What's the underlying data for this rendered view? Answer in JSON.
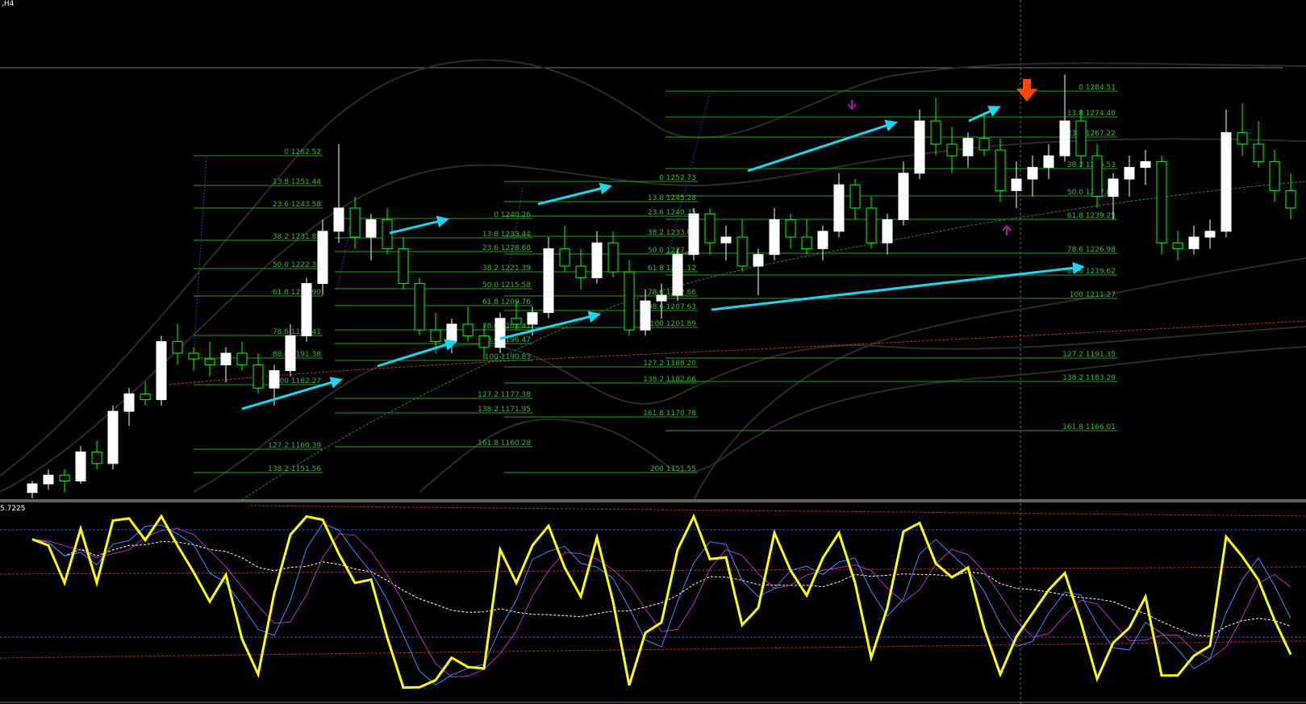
{
  "window_title": ",H4",
  "oscillator": {
    "value_label": "5.7225"
  },
  "colors": {
    "background": "#000000",
    "fib": "#1f9e1f",
    "fib_text": "#2fb82f",
    "bull_candle": "#ffffff",
    "bear_candle": "#00ff00",
    "arrow": "#1ad6f0",
    "sell_arrow": "#ff4500",
    "fractal": "#a020a0",
    "stoch_main": "#ffff00",
    "stoch_blue": "#3a8cff",
    "stoch_magenta": "#b030c0",
    "levels": "#c02020",
    "envelope": "#2a2a2a"
  },
  "fib_sets": [
    {
      "id": "fib-set-1",
      "levels": [
        "0 1262.52",
        "13.8 1251.44",
        "23.6 1243.58",
        "38.2 1231.85",
        "50.0 1222.38",
        "61.8 1212.90",
        "78.6 1199.41",
        "88.6 1191.38",
        "100 1182.27",
        "127.2 1160.39",
        "138.2 1151.56"
      ]
    },
    {
      "id": "fib-set-2",
      "levels": [
        "0 1240.26",
        "13.8 1233.44",
        "23.6 1228.60",
        "38.2 1221.39",
        "50.0 1215.58",
        "61.8 1209.76",
        "78.6 1201.41",
        "88.6 1196.47",
        "100 1190.83",
        "127.2 1177.38",
        "138.2 1171.95",
        "161.8 1160.28"
      ]
    },
    {
      "id": "fib-set-3",
      "levels": [
        "0 1252.73",
        "13.8 1245.28",
        "23.6 1240.35",
        "38.2 1233.08",
        "50.0 1227.23",
        "61.8 1221.12",
        "78.6 1212.66",
        "88.6 1207.63",
        "100 1201.89",
        "127.2 1188.20",
        "138.2 1182.66",
        "161.8 1170.78",
        "200 1151.55"
      ]
    },
    {
      "id": "fib-set-4",
      "levels": [
        "0 1284.51",
        "13.8 1274.40",
        "23.6 1267.22",
        "38.2 1256.53",
        "50.0 1247.89",
        "61.8 1239.25",
        "78.6 1226.98",
        "88.6 1219.62",
        "100 1211.27",
        "127.2 1191.35",
        "138.2 1183.29",
        "161.8 1166.01"
      ]
    }
  ],
  "chart_data": {
    "type": "candlestick",
    "timeframe": "H4",
    "series": [
      {
        "name": "price",
        "ohlc_approx": [
          [
            1142,
            1146,
            1140,
            1145
          ],
          [
            1145,
            1150,
            1143,
            1148
          ],
          [
            1148,
            1150,
            1142,
            1146
          ],
          [
            1146,
            1158,
            1145,
            1156
          ],
          [
            1156,
            1160,
            1150,
            1152
          ],
          [
            1152,
            1172,
            1150,
            1170
          ],
          [
            1170,
            1178,
            1165,
            1176
          ],
          [
            1176,
            1180,
            1172,
            1174
          ],
          [
            1174,
            1196,
            1172,
            1194
          ],
          [
            1194,
            1200,
            1186,
            1190
          ],
          [
            1190,
            1192,
            1184,
            1188
          ],
          [
            1188,
            1194,
            1182,
            1186
          ],
          [
            1186,
            1192,
            1180,
            1190
          ],
          [
            1190,
            1194,
            1184,
            1186
          ],
          [
            1186,
            1190,
            1176,
            1178
          ],
          [
            1178,
            1186,
            1172,
            1184
          ],
          [
            1184,
            1200,
            1182,
            1196
          ],
          [
            1196,
            1216,
            1194,
            1214
          ],
          [
            1214,
            1236,
            1210,
            1232
          ],
          [
            1232,
            1262,
            1228,
            1240
          ],
          [
            1240,
            1244,
            1226,
            1230
          ],
          [
            1230,
            1238,
            1222,
            1236
          ],
          [
            1236,
            1240,
            1224,
            1226
          ],
          [
            1226,
            1230,
            1212,
            1214
          ],
          [
            1214,
            1216,
            1196,
            1198
          ],
          [
            1198,
            1204,
            1190,
            1194
          ],
          [
            1194,
            1202,
            1190,
            1200
          ],
          [
            1200,
            1206,
            1194,
            1196
          ],
          [
            1196,
            1200,
            1188,
            1192
          ],
          [
            1192,
            1204,
            1190,
            1202
          ],
          [
            1202,
            1208,
            1198,
            1200
          ],
          [
            1200,
            1206,
            1196,
            1204
          ],
          [
            1204,
            1230,
            1202,
            1226
          ],
          [
            1226,
            1234,
            1218,
            1220
          ],
          [
            1220,
            1226,
            1212,
            1216
          ],
          [
            1216,
            1232,
            1214,
            1228
          ],
          [
            1228,
            1232,
            1216,
            1218
          ],
          [
            1218,
            1222,
            1196,
            1198
          ],
          [
            1198,
            1212,
            1196,
            1208
          ],
          [
            1208,
            1214,
            1202,
            1210
          ],
          [
            1210,
            1226,
            1208,
            1224
          ],
          [
            1224,
            1240,
            1222,
            1238
          ],
          [
            1238,
            1240,
            1224,
            1228
          ],
          [
            1228,
            1234,
            1222,
            1230
          ],
          [
            1230,
            1236,
            1218,
            1220
          ],
          [
            1220,
            1226,
            1210,
            1224
          ],
          [
            1224,
            1240,
            1222,
            1236
          ],
          [
            1236,
            1238,
            1226,
            1230
          ],
          [
            1230,
            1236,
            1224,
            1226
          ],
          [
            1226,
            1234,
            1222,
            1232
          ],
          [
            1232,
            1252,
            1230,
            1248
          ],
          [
            1248,
            1250,
            1236,
            1240
          ],
          [
            1240,
            1244,
            1226,
            1228
          ],
          [
            1228,
            1238,
            1224,
            1236
          ],
          [
            1236,
            1256,
            1234,
            1252
          ],
          [
            1252,
            1274,
            1250,
            1270
          ],
          [
            1270,
            1278,
            1258,
            1262
          ],
          [
            1262,
            1268,
            1252,
            1258
          ],
          [
            1258,
            1266,
            1254,
            1264
          ],
          [
            1264,
            1272,
            1258,
            1260
          ],
          [
            1260,
            1264,
            1242,
            1246
          ],
          [
            1246,
            1256,
            1240,
            1250
          ],
          [
            1250,
            1258,
            1244,
            1254
          ],
          [
            1254,
            1262,
            1250,
            1258
          ],
          [
            1258,
            1286,
            1256,
            1270
          ],
          [
            1270,
            1274,
            1254,
            1258
          ],
          [
            1258,
            1262,
            1240,
            1244
          ],
          [
            1244,
            1252,
            1236,
            1250
          ],
          [
            1250,
            1258,
            1244,
            1254
          ],
          [
            1254,
            1260,
            1248,
            1256
          ],
          [
            1256,
            1258,
            1224,
            1228
          ],
          [
            1228,
            1232,
            1222,
            1226
          ],
          [
            1226,
            1234,
            1224,
            1230
          ],
          [
            1230,
            1236,
            1226,
            1232
          ],
          [
            1232,
            1274,
            1230,
            1266
          ],
          [
            1266,
            1276,
            1258,
            1262
          ],
          [
            1262,
            1270,
            1254,
            1256
          ],
          [
            1256,
            1260,
            1242,
            1246
          ],
          [
            1246,
            1252,
            1236,
            1240
          ]
        ]
      }
    ],
    "oscillator": {
      "name": "Stochastic",
      "value_label": "5.7225",
      "ylim": [
        0,
        100
      ],
      "levels": [
        80,
        20
      ]
    }
  }
}
